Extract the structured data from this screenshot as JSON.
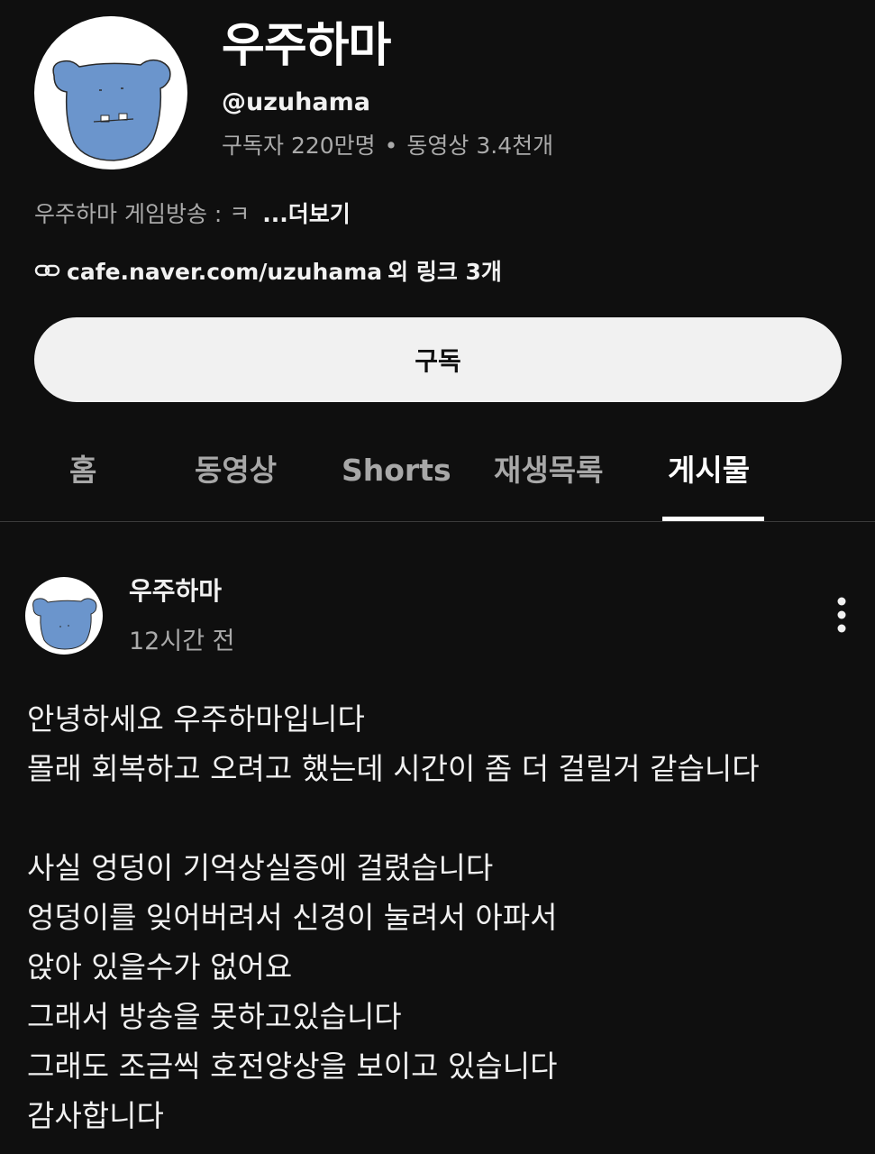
{
  "channel": {
    "name": "우주하마",
    "handle": "@uzuhama",
    "subscribers": "구독자 220만명",
    "videos": "동영상 3.4천개",
    "description": "우주하마 게임방송 : ㅋ",
    "more_label": "...더보기",
    "link_url": "cafe.naver.com/uzuhama",
    "link_extra": "외 링크 3개",
    "subscribe_label": "구독"
  },
  "tabs": [
    {
      "label": "홈",
      "active": false
    },
    {
      "label": "동영상",
      "active": false
    },
    {
      "label": "Shorts",
      "active": false
    },
    {
      "label": "재생목록",
      "active": false
    },
    {
      "label": "게시물",
      "active": true
    }
  ],
  "post": {
    "author": "우주하마",
    "time": "12시간 전",
    "lines": [
      "안녕하세요 우주하마입니다",
      "몰래 회복하고 오려고 했는데 시간이 좀 더 걸릴거 같습니다",
      "",
      "사실 엉덩이 기억상실증에 걸렸습니다",
      "엉덩이를 잊어버려서 신경이 눌려서 아파서",
      "앉아 있을수가 없어요",
      "그래서 방송을 못하고있습니다",
      "그래도 조금씩 호전양상을 보이고 있습니다",
      "감사합니다"
    ]
  },
  "colors": {
    "background": "#0f0f0f",
    "avatar_blue": "#6b95cc",
    "subscribe_bg": "#f1f1f1",
    "secondary_text": "#aaaaaa"
  },
  "icons": {
    "link": "link-icon",
    "more": "more-vert-icon",
    "avatar": "blue-hippo-avatar"
  }
}
